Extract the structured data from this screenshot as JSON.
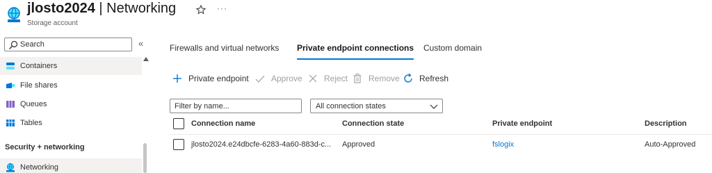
{
  "header": {
    "resource_name": "jlosto2024",
    "separator_title": " | Networking",
    "subtitle": "Storage account",
    "favorite_icon": "star-outline-icon",
    "more_label": "···"
  },
  "sidebar": {
    "search_placeholder": "Search",
    "collapse_label": "«",
    "items": [
      {
        "label": "Containers",
        "icon": "containers-icon",
        "color": "#0078d4"
      },
      {
        "label": "File shares",
        "icon": "file-shares-icon",
        "color": "#0078d4"
      },
      {
        "label": "Queues",
        "icon": "queues-icon",
        "color": "#8661c5"
      },
      {
        "label": "Tables",
        "icon": "tables-icon",
        "color": "#0078d4"
      }
    ],
    "section_heading": "Security + networking",
    "selected_item": {
      "label": "Networking",
      "icon": "networking-icon",
      "color": "#0078d4"
    }
  },
  "tabs": [
    {
      "label": "Firewalls and virtual networks",
      "active": false
    },
    {
      "label": "Private endpoint connections",
      "active": true
    },
    {
      "label": "Custom domain",
      "active": false
    }
  ],
  "toolbar": {
    "add_label": "Private endpoint",
    "approve_label": "Approve",
    "reject_label": "Reject",
    "remove_label": "Remove",
    "refresh_label": "Refresh"
  },
  "filters": {
    "name_placeholder": "Filter by name...",
    "state_value": "All connection states"
  },
  "table": {
    "columns": [
      "Connection name",
      "Connection state",
      "Private endpoint",
      "Description"
    ],
    "rows": [
      {
        "connection_name": "jlosto2024.e24dbcfe-6283-4a60-883d-c...",
        "connection_state": "Approved",
        "private_endpoint": "fslogix",
        "description": "Auto-Approved"
      }
    ]
  },
  "colors": {
    "accent": "#0078d4",
    "text": "#323130",
    "disabled": "#a19f9d"
  }
}
